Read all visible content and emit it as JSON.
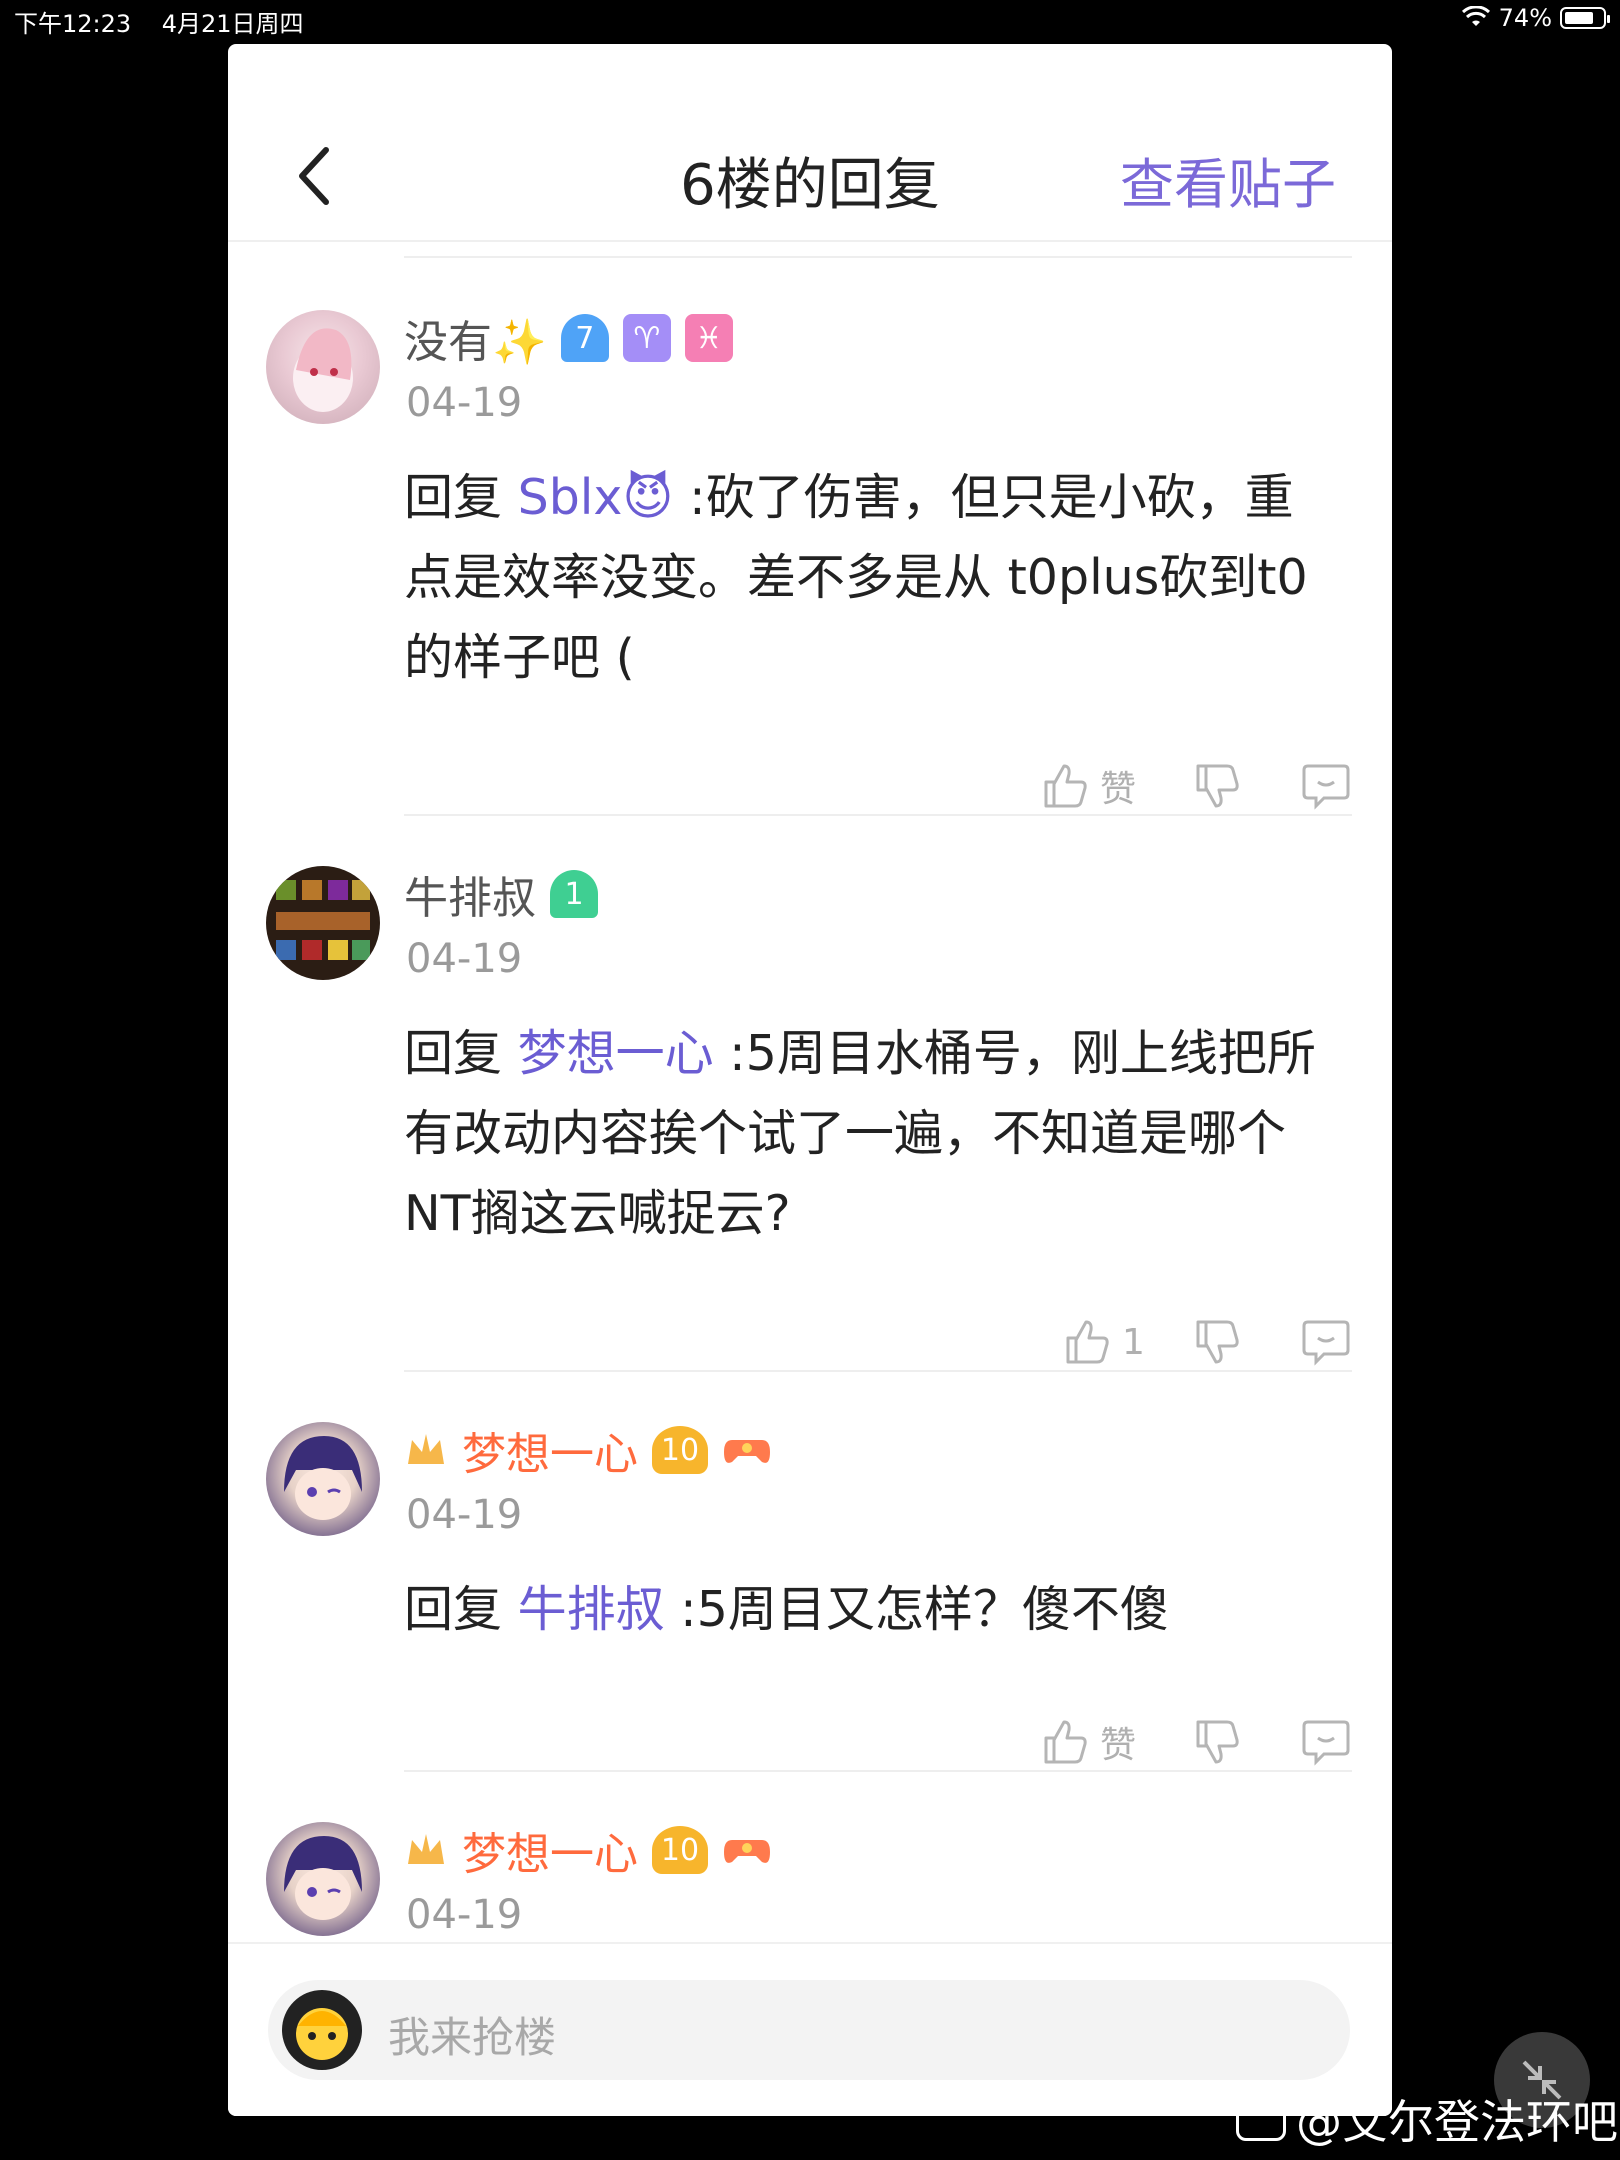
{
  "status_bar": {
    "time": "下午12:23",
    "date": "4月21日周四",
    "battery": "74%"
  },
  "nav": {
    "title": "6楼的回复",
    "view_post": "查看贴子"
  },
  "comments": [
    {
      "name": "没有✨",
      "date": "04-19",
      "reply_prefix": "回复",
      "mention": "Sblx😈",
      "text": " :砍了伤害，但只是小砍，重点是效率没变。差不多是从 t0plus砍到t0的样子吧 (",
      "like_label": "赞",
      "badges": {
        "level": "7",
        "b2": "♈",
        "b3": "♓"
      }
    },
    {
      "name": "牛排叔",
      "date": "04-19",
      "reply_prefix": "回复",
      "mention": "梦想一心",
      "text": " :5周目水桶号，刚上线把所有改动内容挨个试了一遍，不知道是哪个NT搁这云喊捉云?",
      "like_label": "1",
      "badges": {
        "level": "1"
      }
    },
    {
      "name": "梦想一心",
      "date": "04-19",
      "reply_prefix": "回复",
      "mention": "牛排叔",
      "text": " :5周目又怎样？傻不傻",
      "like_label": "赞",
      "badges": {
        "level": "10"
      }
    },
    {
      "name": "梦想一心",
      "date": "04-19",
      "badges": {
        "level": "10"
      }
    }
  ],
  "footer": {
    "placeholder": "我来抢楼"
  },
  "watermark": "@艾尔登法环吧",
  "colors": {
    "accent": "#7b69d8",
    "vip_name": "#ff6a3d",
    "mention": "#6b5dd3"
  }
}
